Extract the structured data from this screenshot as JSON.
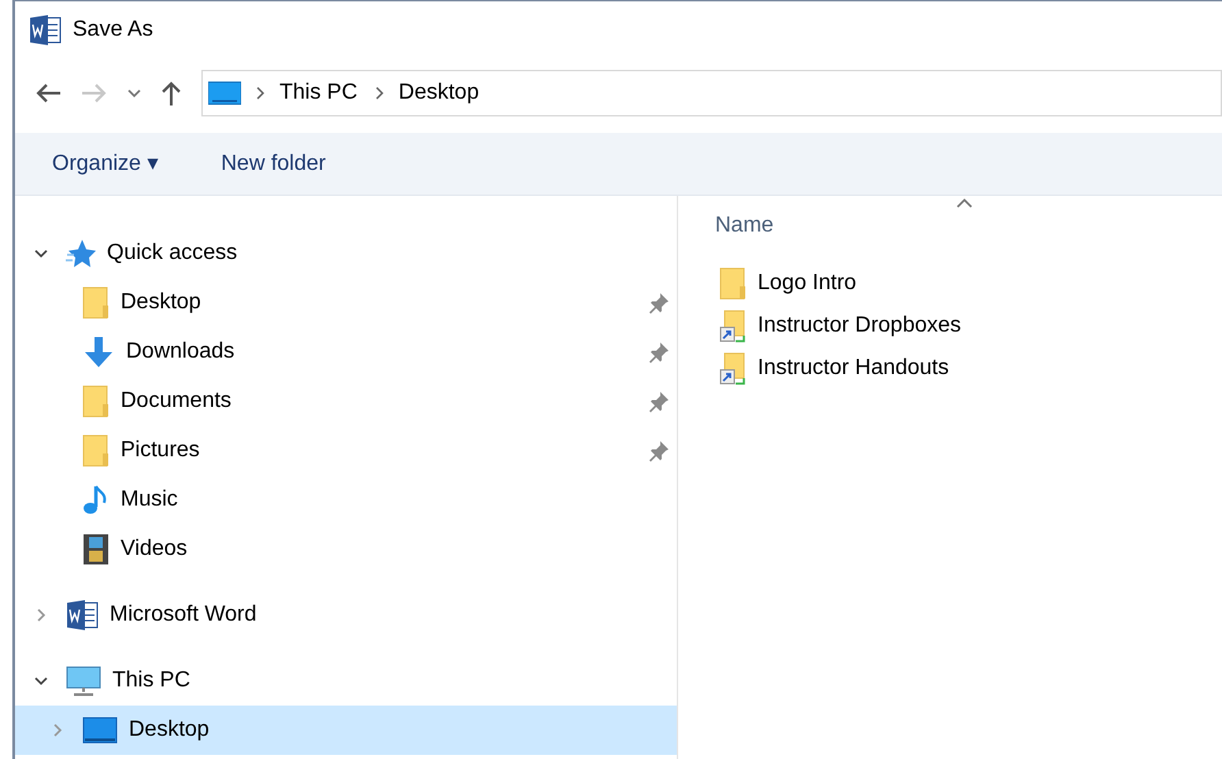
{
  "window": {
    "title": "Save As"
  },
  "address_bar": {
    "crumbs": [
      "This PC",
      "Desktop"
    ]
  },
  "toolbar": {
    "organize": "Organize ▾",
    "new_folder": "New folder"
  },
  "navigation": [
    {
      "label": "Quick access",
      "kind": "star",
      "expanded": true,
      "selected": false,
      "children": [
        {
          "label": "Desktop",
          "kind": "folder",
          "pinned": true,
          "selected": false
        },
        {
          "label": "Downloads",
          "kind": "download",
          "pinned": true,
          "selected": false
        },
        {
          "label": "Documents",
          "kind": "folder",
          "pinned": true,
          "selected": false
        },
        {
          "label": "Pictures",
          "kind": "folder",
          "pinned": true,
          "selected": false
        },
        {
          "label": "Music",
          "kind": "music",
          "pinned": false,
          "selected": false
        },
        {
          "label": "Videos",
          "kind": "video",
          "pinned": false,
          "selected": false
        }
      ]
    },
    {
      "label": "Microsoft Word",
      "kind": "word",
      "expanded": false,
      "selected": false
    },
    {
      "label": "This PC",
      "kind": "pc",
      "expanded": true,
      "selected": false,
      "children": [
        {
          "label": "Desktop",
          "kind": "desktop",
          "expanded": false,
          "selected": true
        }
      ]
    }
  ],
  "file_list": {
    "columns": [
      "Name"
    ],
    "sort_ascending": true,
    "rows": [
      {
        "name": "Logo Intro",
        "kind": "folder"
      },
      {
        "name": "Instructor Dropboxes",
        "kind": "shortcut"
      },
      {
        "name": "Instructor Handouts",
        "kind": "shortcut"
      }
    ]
  }
}
